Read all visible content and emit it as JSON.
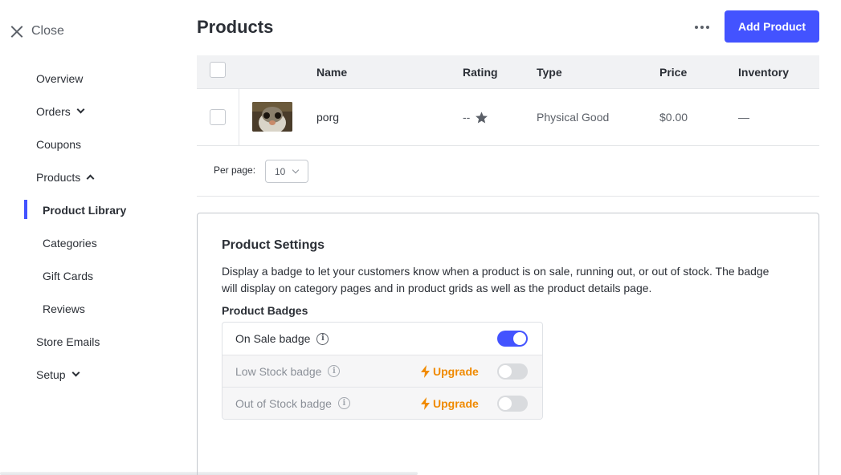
{
  "sidebar": {
    "close_label": "Close",
    "items": [
      {
        "label": "Overview"
      },
      {
        "label": "Orders"
      },
      {
        "label": "Coupons"
      },
      {
        "label": "Products"
      },
      {
        "label": "Product Library"
      },
      {
        "label": "Categories"
      },
      {
        "label": "Gift Cards"
      },
      {
        "label": "Reviews"
      },
      {
        "label": "Store Emails"
      },
      {
        "label": "Setup"
      }
    ]
  },
  "header": {
    "title": "Products",
    "add_button": "Add Product"
  },
  "table": {
    "columns": [
      "Name",
      "Rating",
      "Type",
      "Price",
      "Inventory"
    ],
    "rows": [
      {
        "name": "porg",
        "rating": "--",
        "type": "Physical Good",
        "price": "$0.00",
        "inventory": "—"
      }
    ]
  },
  "pagination": {
    "per_page_label": "Per page:",
    "per_page_value": "10"
  },
  "settings": {
    "title": "Product Settings",
    "description": "Display a badge to let your customers know when a product is on sale, running out, or out of stock. The badge will display on category pages and in product grids as well as the product details page.",
    "badges_title": "Product Badges",
    "badges": [
      {
        "label": "On Sale badge",
        "enabled": true,
        "upgrade": ""
      },
      {
        "label": "Low Stock badge",
        "enabled": false,
        "upgrade": "Upgrade"
      },
      {
        "label": "Out of Stock badge",
        "enabled": false,
        "upgrade": "Upgrade"
      }
    ]
  },
  "colors": {
    "accent": "#4353ff",
    "upgrade": "#f08a00"
  },
  "icons": [
    "close-icon",
    "more-icon",
    "star-icon",
    "info-icon",
    "bolt-icon",
    "chevron-down-icon",
    "chevron-up-icon"
  ]
}
